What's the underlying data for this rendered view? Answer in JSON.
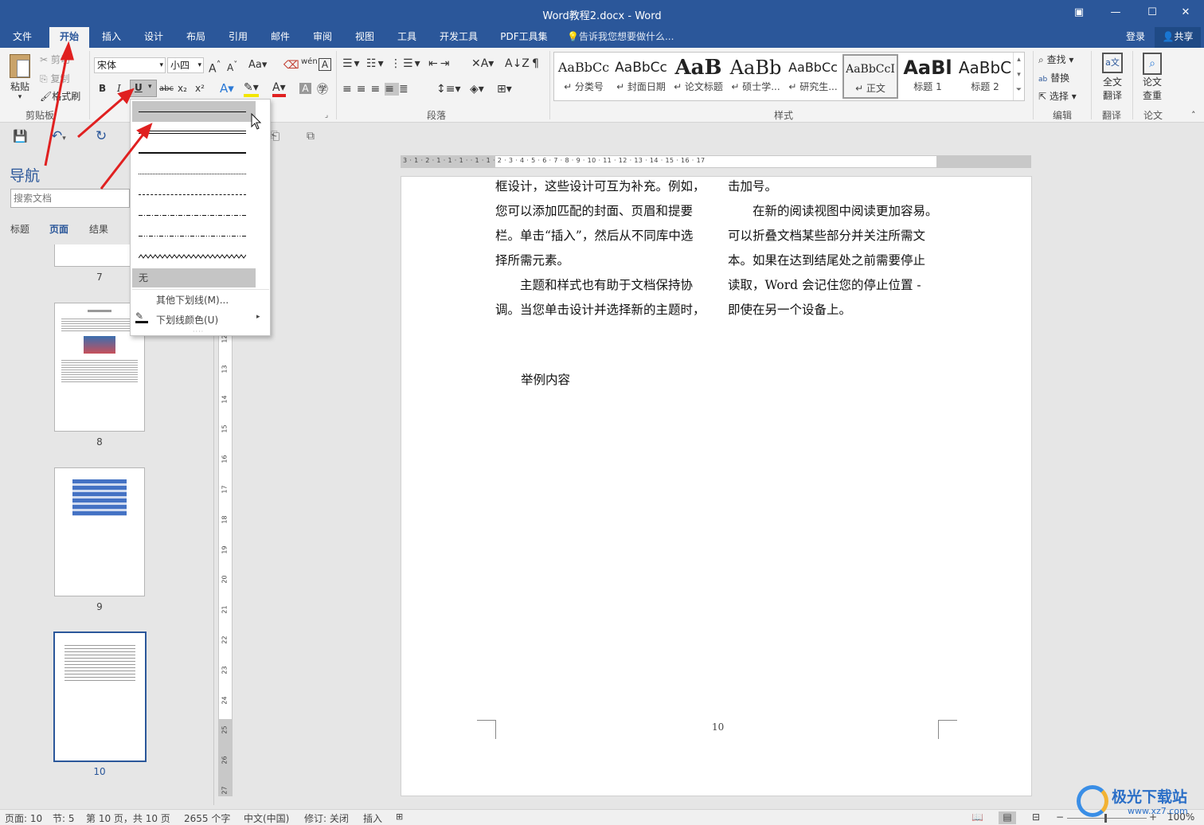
{
  "title": "Word教程2.docx - Word",
  "window": {
    "restore_icon": "▣",
    "min": "—",
    "max": "☐",
    "close": "✕"
  },
  "tabs": [
    "文件",
    "开始",
    "插入",
    "设计",
    "布局",
    "引用",
    "邮件",
    "审阅",
    "视图",
    "工具",
    "开发工具",
    "PDF工具集"
  ],
  "tell_me": "告诉我您想要做什么...",
  "login": "登录",
  "share": "共享",
  "clipboard": {
    "paste": "粘贴",
    "cut": "剪切",
    "copy": "复制",
    "format_painter": "格式刷",
    "group": "剪贴板"
  },
  "font": {
    "name": "宋体",
    "size": "小四",
    "case": "Aa",
    "bold": "B",
    "italic": "I",
    "underline": "U",
    "strike": "abc",
    "sub": "x₂",
    "sup": "x²",
    "group": ""
  },
  "paragraph": {
    "group": "段落"
  },
  "styles": {
    "group": "样式",
    "items": [
      {
        "sample": "AaBbCc",
        "name": "↵ 分类号"
      },
      {
        "sample": "AaBbCc",
        "name": "↵ 封面日期"
      },
      {
        "sample": "AaB",
        "name": "↵ 论文标题"
      },
      {
        "sample": "AaBb",
        "name": "↵ 硕士学..."
      },
      {
        "sample": "AaBbCc",
        "name": "↵ 研究生..."
      },
      {
        "sample": "AaBbCcI",
        "name": "↵ 正文"
      },
      {
        "sample": "AaBl",
        "name": "标题 1"
      },
      {
        "sample": "AaBbC",
        "name": "标题 2"
      }
    ]
  },
  "editing": {
    "find": "查找",
    "replace": "替换",
    "select": "选择",
    "group": "编辑"
  },
  "translate": {
    "label1": "全文",
    "label2": "翻译",
    "group": "翻译"
  },
  "paper": {
    "label1": "论文",
    "label2": "查重",
    "group": "论文"
  },
  "nav": {
    "title": "导航",
    "search_placeholder": "搜索文档",
    "tabs": [
      "标题",
      "页面",
      "结果"
    ],
    "pages": [
      "7",
      "8",
      "9",
      "10"
    ]
  },
  "dropdown": {
    "none": "无",
    "more": "其他下划线(M)...",
    "color": "下划线颜色(U)"
  },
  "hruler": "3 · 1 · 2 · 1 · 1 · 1 ·   · 1 · 1 · 2 · 3 · 4 · 5 · 6 · 7 · 8 · 9 · 10 · 11 · 12 · 13 · 14 · 15 · 16 · 17",
  "vruler": [
    "12",
    "13",
    "14",
    "15",
    "16",
    "17",
    "18",
    "19",
    "20",
    "21",
    "22",
    "23",
    "24",
    "25",
    "26",
    "27"
  ],
  "doc": {
    "left": [
      "框设计，这些设计可互为补充。例如，",
      "您可以添加匹配的封面、页眉和提要",
      "栏。单击“插入”，然后从不同库中选",
      "择所需元素。",
      "　　主题和样式也有助于文档保持协",
      "调。当您单击设计并选择新的主题时，"
    ],
    "right": [
      "击加号。",
      "　　在新的阅读视图中阅读更加容易。",
      "可以折叠文档某些部分并关注所需文",
      "本。如果在达到结尾处之前需要停止",
      "读取，Word 会记住您的停止位置 -",
      "即使在另一个设备上。"
    ],
    "example": "举例内容",
    "page_number": "10"
  },
  "status": {
    "page": "页面: 10",
    "section": "节: 5",
    "pages": "第 10 页，共 10 页",
    "words": "2655 个字",
    "lang": "中文(中国)",
    "track": "修订: 关闭",
    "mode": "插入",
    "zoom": "100%"
  },
  "watermark": "极光下载站",
  "watermark_url": "www.xz7.com"
}
